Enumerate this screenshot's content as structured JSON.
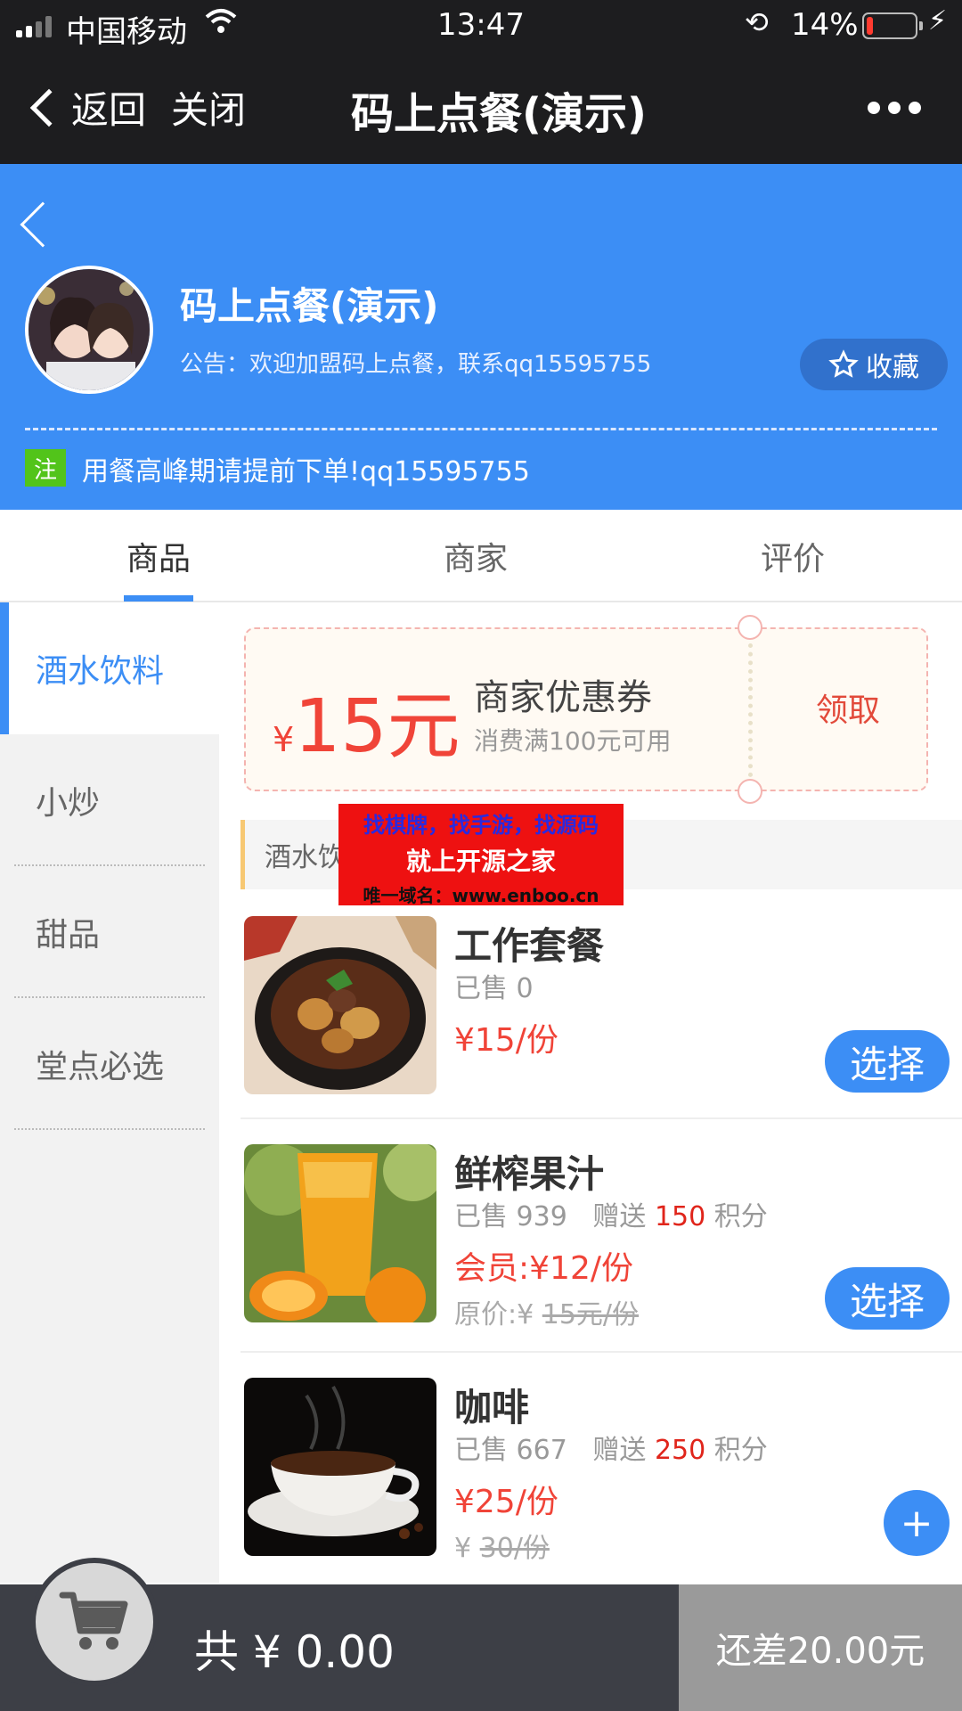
{
  "status_bar": {
    "carrier": "中国移动",
    "time": "13:47",
    "battery_percent": "14%",
    "battery_level": 0.14,
    "battery_color": "#ff3b30"
  },
  "nav_bar": {
    "back_label": "返回",
    "close_label": "关闭",
    "title": "码上点餐(演示)",
    "more_icon": "more-dots-icon"
  },
  "shop": {
    "name": "码上点餐(演示)",
    "notice": "公告：欢迎加盟码上点餐，联系qq15595755",
    "favorite_label": "收藏",
    "tip_badge": "注",
    "tip_text": "用餐高峰期请提前下单!qq15595755",
    "header_color": "#3c8ef5"
  },
  "tabs": [
    {
      "label": "商品",
      "active": true
    },
    {
      "label": "商家",
      "active": false
    },
    {
      "label": "评价",
      "active": false
    }
  ],
  "categories": [
    {
      "label": "酒水饮料",
      "active": true
    },
    {
      "label": "小炒",
      "active": false
    },
    {
      "label": "甜品",
      "active": false
    },
    {
      "label": "堂点必选",
      "active": false
    }
  ],
  "coupon": {
    "currency": "¥",
    "amount": "15元",
    "title": "商家优惠券",
    "condition": "消费满100元可用",
    "claim_label": "领取"
  },
  "section_title": "酒水饮料",
  "watermark": {
    "line1": "找棋牌，找手游，找源码",
    "line2": "就上开源之家",
    "line3": "唯一域名：www.enboo.cn"
  },
  "items": [
    {
      "name": "工作套餐",
      "sold": "已售 0",
      "price": "¥15/份",
      "action_label": "选择",
      "image": "claypot-stew"
    },
    {
      "name": "鲜榨果汁",
      "sold": "已售 939",
      "gift_prefix": "赠送",
      "points": "150",
      "points_suffix": "积分",
      "price": "会员:¥12/份",
      "orig_prefix": "原价:¥",
      "orig_price": "15元/份",
      "action_label": "选择",
      "image": "orange-juice"
    },
    {
      "name": "咖啡",
      "sold": "已售 667",
      "gift_prefix": "赠送",
      "points": "250",
      "points_suffix": "积分",
      "price": "¥25/份",
      "orig_prefix": "¥",
      "orig_price": "30/份",
      "action_label": "+",
      "image": "coffee-cup"
    }
  ],
  "bottom_bar": {
    "total": "共 ¥ 0.00",
    "shortfall": "还差20.00元",
    "cart_icon": "cart-icon"
  }
}
